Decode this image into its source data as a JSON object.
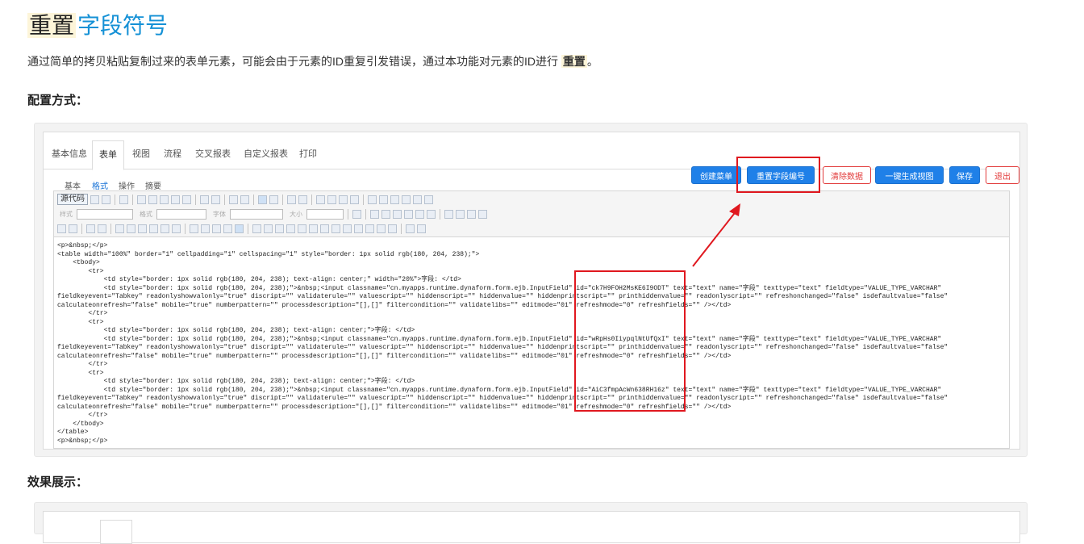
{
  "heading": {
    "highlight": "重置",
    "rest": "字段符号"
  },
  "intro": {
    "text": "通过简单的拷贝粘贴复制过来的表单元素，可能会由于元素的ID重复引发错误，通过本功能对元素的ID进行",
    "highlight": "重置",
    "end": "。"
  },
  "config_label": "配置方式：",
  "effect_label": "效果展示：",
  "editor": {
    "tabs": [
      "基本信息",
      "表单",
      "视图",
      "流程",
      "交叉报表",
      "自定义报表",
      "打印"
    ],
    "active_tab": "表单",
    "subtabs": [
      "基本",
      "格式",
      "操作",
      "摘要"
    ],
    "active_subtab": "格式",
    "buttons": {
      "create_menu": "创建菜单",
      "reset_ids": "重置字段编号",
      "clear_data": "清除数据",
      "generate_view": "一键生成视图",
      "save": "保存",
      "exit": "退出"
    },
    "toolbar": {
      "source": "源代码",
      "style_label": "样式",
      "format_label": "格式",
      "font_label": "字体",
      "size_label": "大小"
    },
    "code_lines": [
      "<p>&nbsp;</p>",
      "<table width=\"100%\" border=\"1\" cellpadding=\"1\" cellspacing=\"1\" style=\"border: 1px solid rgb(180, 204, 238);\">",
      "    <tbody>",
      "        <tr>",
      "            <td style=\"border: 1px solid rgb(180, 204, 238); text-align: center;\" width=\"20%\">字段: </td>",
      "            <td style=\"border: 1px solid rgb(180, 204, 238);\">&nbsp;<input classname=\"cn.myapps.runtime.dynaform.form.ejb.InputField\" id=\"ck7H9FOH2MsKE6I9ODT\" text=\"text\" name=\"字段\" texttype=\"text\" fieldtype=\"VALUE_TYPE_VARCHAR\"",
      "fieldkeyevent=\"Tabkey\" readonlyshowvalonly=\"true\" discript=\"\" validaterule=\"\" valuescript=\"\" hiddenscript=\"\" hiddenvalue=\"\" hiddenprintscript=\"\" printhiddenvalue=\"\" readonlyscript=\"\" refreshonchanged=\"false\" isdefaultvalue=\"false\"",
      "calculateonrefresh=\"false\" mobile=\"true\" numberpattern=\"\" processdescription=\"[],[]\" filtercondition=\"\" validatelibs=\"\" editmode=\"01\" refreshmode=\"0\" refreshfields=\"\" /></td>",
      "        </tr>",
      "        <tr>",
      "            <td style=\"border: 1px solid rgb(180, 204, 238); text-align: center;\">字段: </td>",
      "            <td style=\"border: 1px solid rgb(180, 204, 238);\">&nbsp;<input classname=\"cn.myapps.runtime.dynaform.form.ejb.InputField\" id=\"wRpHs0IiypqlNtUfQxI\" text=\"text\" name=\"字段\" texttype=\"text\" fieldtype=\"VALUE_TYPE_VARCHAR\"",
      "fieldkeyevent=\"Tabkey\" readonlyshowvalonly=\"true\" discript=\"\" validaterule=\"\" valuescript=\"\" hiddenscript=\"\" hiddenvalue=\"\" hiddenprintscript=\"\" printhiddenvalue=\"\" readonlyscript=\"\" refreshonchanged=\"false\" isdefaultvalue=\"false\"",
      "calculateonrefresh=\"false\" mobile=\"true\" numberpattern=\"\" processdescription=\"[],[]\" filtercondition=\"\" validatelibs=\"\" editmode=\"01\" refreshmode=\"0\" refreshfields=\"\" /></td>",
      "        </tr>",
      "        <tr>",
      "            <td style=\"border: 1px solid rgb(180, 204, 238); text-align: center;\">字段: </td>",
      "            <td style=\"border: 1px solid rgb(180, 204, 238);\">&nbsp;<input classname=\"cn.myapps.runtime.dynaform.form.ejb.InputField\" id=\"AiC3fmpAcWn638RH16z\" text=\"text\" name=\"字段\" texttype=\"text\" fieldtype=\"VALUE_TYPE_VARCHAR\"",
      "fieldkeyevent=\"Tabkey\" readonlyshowvalonly=\"true\" discript=\"\" validaterule=\"\" valuescript=\"\" hiddenscript=\"\" hiddenvalue=\"\" hiddenprintscript=\"\" printhiddenvalue=\"\" readonlyscript=\"\" refreshonchanged=\"false\" isdefaultvalue=\"false\"",
      "calculateonrefresh=\"false\" mobile=\"true\" numberpattern=\"\" processdescription=\"[],[]\" filtercondition=\"\" validatelibs=\"\" editmode=\"01\" refreshmode=\"0\" refreshfields=\"\" /></td>",
      "        </tr>",
      "    </tbody>",
      "</table>",
      "<p>&nbsp;</p>"
    ]
  },
  "colors": {
    "accent_blue": "#1591d6",
    "button_blue": "#1f80e8",
    "annotation_red": "#e0181f",
    "highlight_bg": "#fdf5d9"
  }
}
